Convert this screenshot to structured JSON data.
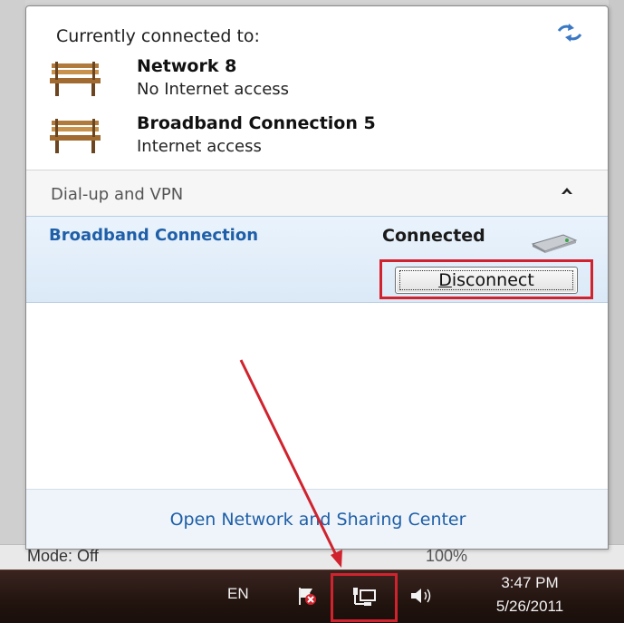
{
  "flyout": {
    "title": "Currently connected to:",
    "connections": [
      {
        "name": "Network  8",
        "status": "No Internet access"
      },
      {
        "name": "Broadband Connection  5",
        "status": "Internet access"
      }
    ],
    "dialup_section": "Dial-up and VPN",
    "vpn": {
      "name": "Broadband Connection",
      "status": "Connected",
      "button_prefix": "",
      "button_accel": "D",
      "button_rest": "isconnect"
    },
    "footer_link": "Open Network and Sharing Center"
  },
  "background_window": {
    "left_text": "Mode: Off",
    "right_text": "100%"
  },
  "taskbar": {
    "language": "EN",
    "time": "3:47 PM",
    "date": "5/26/2011"
  },
  "icons": {
    "refresh": "refresh-icon",
    "network": "bench-network-icon",
    "modem": "modem-icon",
    "chevron": "chevron-up-icon",
    "action_center": "action-center-flag-icon",
    "tray_network": "network-tray-icon",
    "volume": "volume-icon"
  },
  "colors": {
    "highlight_box": "#d0232d",
    "link": "#1f5fa8",
    "taskbar": "#22140f"
  }
}
